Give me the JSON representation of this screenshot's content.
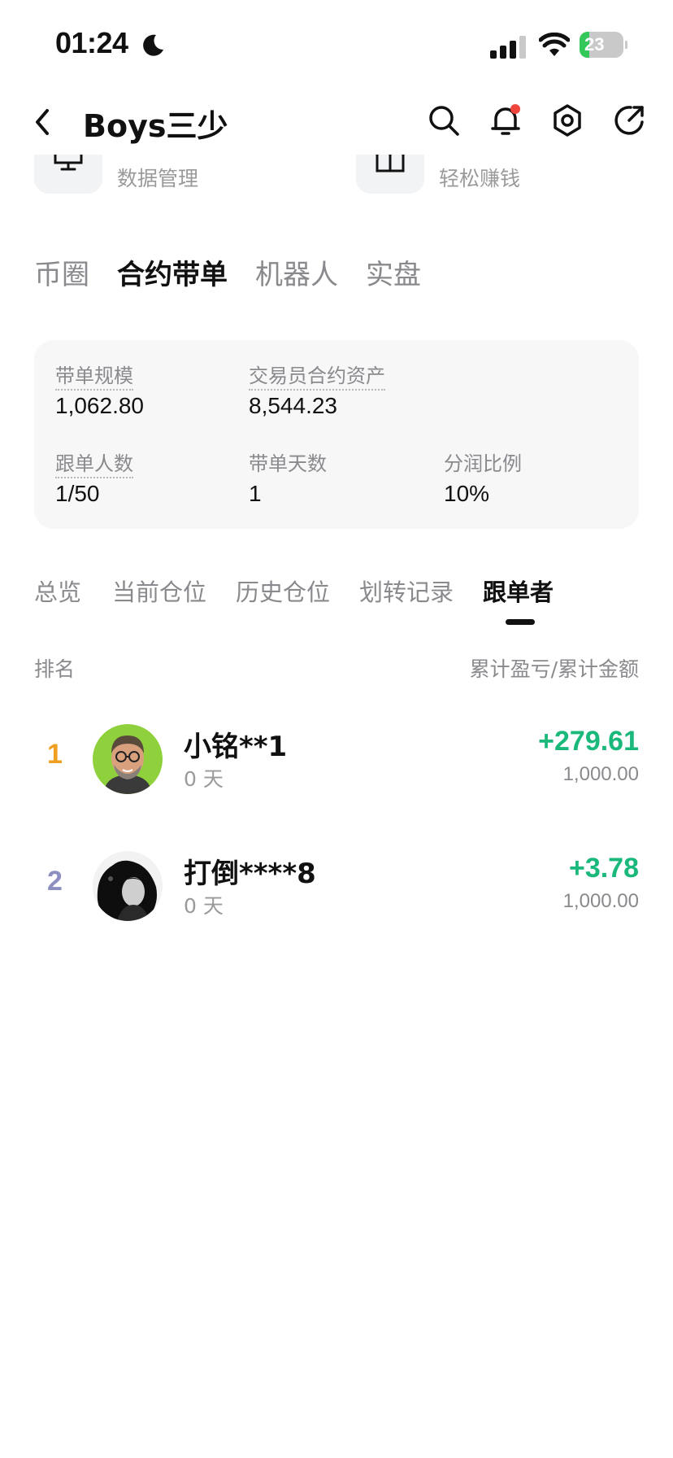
{
  "status_bar": {
    "time": "01:24",
    "battery_level": "23",
    "battery_percent": 23
  },
  "header": {
    "title": "Boys三少",
    "icons": [
      "back-icon",
      "search-icon",
      "bell-icon",
      "settings-icon",
      "share-icon"
    ]
  },
  "quick_actions": [
    {
      "label": "数据管理",
      "icon": "monitor-icon"
    },
    {
      "label": "轻松赚钱",
      "icon": "grid-icon"
    }
  ],
  "category_tabs": [
    {
      "label": "币圈",
      "active": false
    },
    {
      "label": "合约带单",
      "active": true
    },
    {
      "label": "机器人",
      "active": false
    },
    {
      "label": "实盘",
      "active": false
    }
  ],
  "stats": {
    "scale_label": "带单规模",
    "scale_value": "1,062.80",
    "assets_label": "交易员合约资产",
    "assets_value": "8,544.23",
    "followers_label": "跟单人数",
    "followers_value": "1/50",
    "days_label": "带单天数",
    "days_value": "1",
    "profit_share_label": "分润比例",
    "profit_share_value": "10%"
  },
  "sub_tabs": [
    {
      "label": "总览",
      "active": false
    },
    {
      "label": "当前仓位",
      "active": false
    },
    {
      "label": "历史仓位",
      "active": false
    },
    {
      "label": "划转记录",
      "active": false
    },
    {
      "label": "跟单者",
      "active": true
    }
  ],
  "list_header": {
    "rank_label": "排名",
    "pnl_label": "累计盈亏/累计金额"
  },
  "followers": [
    {
      "rank": "1",
      "name": "小铭**1",
      "days": "0 天",
      "pnl": "+279.61",
      "amount": "1,000.00"
    },
    {
      "rank": "2",
      "name": "打倒****8",
      "days": "0 天",
      "pnl": "+3.78",
      "amount": "1,000.00"
    }
  ],
  "colors": {
    "positive": "#1bb87c",
    "rank_1": "#f0a020",
    "rank_2": "#8c8fc0",
    "notification_dot": "#f0443c",
    "battery_green": "#34c759"
  }
}
